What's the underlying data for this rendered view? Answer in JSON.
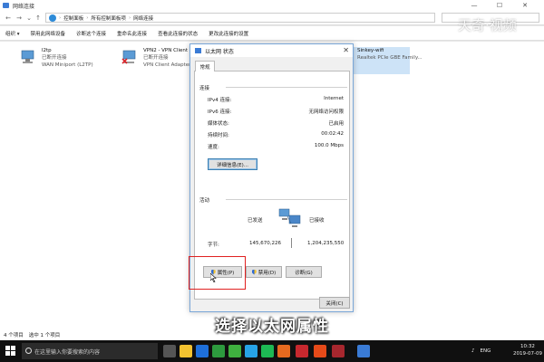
{
  "window": {
    "title": "网络连接",
    "controls": {
      "min": "—",
      "max": "☐",
      "close": "✕"
    }
  },
  "address": {
    "crumbs": [
      "控制面板",
      "所有控制面板项",
      "网络连接"
    ]
  },
  "toolbar": {
    "items": [
      "组织 ▾",
      "禁用此网络设备",
      "诊断这个连接",
      "重命名此连接",
      "查看此连接的状态",
      "更改此连接的设置"
    ]
  },
  "connections": [
    {
      "name": "l2tp",
      "status": "已断开连接",
      "device": "WAN Miniport (L2TP)"
    },
    {
      "name": "VPN2 - VPN Client",
      "status": "已断开连接",
      "device": "VPN Client Adapter"
    },
    {
      "name": "Sinkey-wifi",
      "status": "",
      "device": "Realtek PCIe GBE Family..."
    }
  ],
  "statusbar": {
    "items_count": "4 个项目",
    "selected": "选中 1 个项目"
  },
  "dialog": {
    "title": "以太网 状态",
    "close": "✕",
    "tab": "常规",
    "connection_section": "连接",
    "rows": [
      {
        "label": "IPv4 连接:",
        "value": "Internet"
      },
      {
        "label": "IPv6 连接:",
        "value": "无网络访问权限"
      },
      {
        "label": "媒体状态:",
        "value": "已启用"
      },
      {
        "label": "持续时间:",
        "value": "00:02:42"
      },
      {
        "label": "速度:",
        "value": "100.0 Mbps"
      }
    ],
    "details_button": "详细信息(E)...",
    "activity_section": "活动",
    "sent_label": "已发送",
    "received_label": "已接收",
    "bytes_label": "字节:",
    "bytes_sent": "145,670,226",
    "bytes_received": "1,204,235,550",
    "properties_button": "属性(P)",
    "disable_button": "禁用(D)",
    "diagnose_button": "诊断(G)",
    "close_button": "关闭(C)"
  },
  "caption": "选择以太网属性",
  "watermark": "天奇·视频",
  "taskbar": {
    "search_placeholder": "在这里输入你要搜索的内容",
    "lang": "ENG",
    "time": "10:32",
    "date": "2019-07-09"
  },
  "colors": {
    "highlight": "#e02020",
    "accent": "#3a7bd5"
  }
}
